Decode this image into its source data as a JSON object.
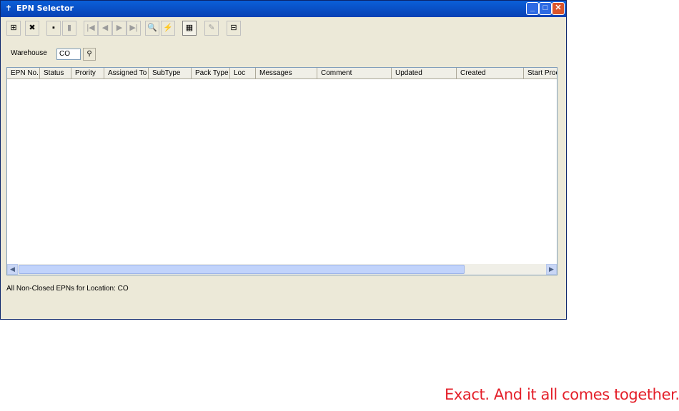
{
  "window": {
    "title": "EPN Selector"
  },
  "titlebar_buttons": {
    "minimize": "_",
    "maximize": "□",
    "close": "✕"
  },
  "toolbar": [
    {
      "name": "new-button",
      "glyph": "⊞",
      "enabled": true
    },
    {
      "name": "delete-button",
      "glyph": "✖",
      "enabled": true
    },
    {
      "name": "save-button",
      "glyph": "▪",
      "enabled": true
    },
    {
      "name": "trash-button",
      "glyph": "▮",
      "enabled": false
    },
    {
      "name": "first-record-button",
      "glyph": "|◀",
      "enabled": false
    },
    {
      "name": "previous-record-button",
      "glyph": "◀",
      "enabled": false
    },
    {
      "name": "next-record-button",
      "glyph": "▶",
      "enabled": false
    },
    {
      "name": "last-record-button",
      "glyph": "▶|",
      "enabled": false
    },
    {
      "name": "preview-button",
      "glyph": "🔍",
      "enabled": true
    },
    {
      "name": "run-button",
      "glyph": "⚡",
      "enabled": true
    },
    {
      "name": "panel-button",
      "glyph": "▦",
      "enabled": true,
      "pressed": true
    },
    {
      "name": "sign-button",
      "glyph": "✎",
      "enabled": false
    },
    {
      "name": "form-button",
      "glyph": "⊟",
      "enabled": true
    }
  ],
  "warehouse": {
    "label": "Warehouse",
    "value": "CO"
  },
  "grid": {
    "columns": [
      "EPN No.",
      "Status",
      "Prority",
      "Assigned To",
      "SubType",
      "Pack Type",
      "Loc",
      "Messages",
      "Comment",
      "Updated",
      "Created",
      "Start Proce"
    ],
    "rows": []
  },
  "status": "All Non-Closed EPNs for Location: CO",
  "tagline": "Exact. And it all comes together.",
  "colors": {
    "titlebar": "#0a5fd8",
    "tagline": "#e4202a"
  }
}
